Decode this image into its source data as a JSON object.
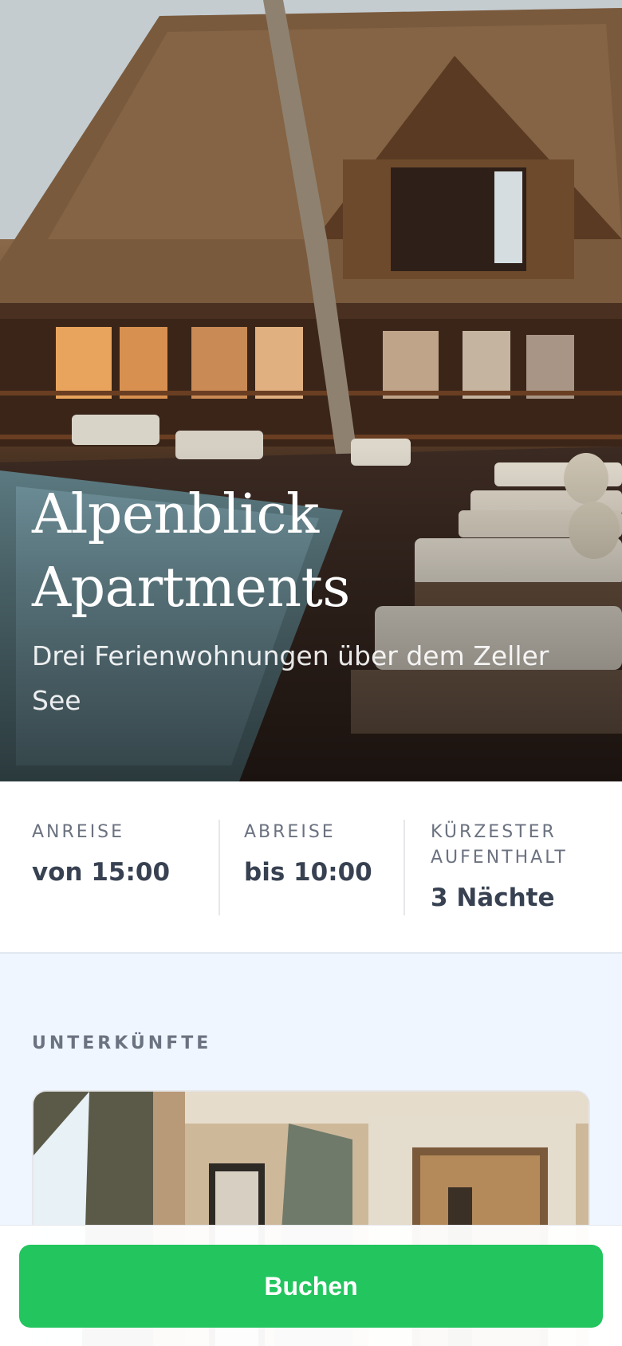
{
  "hero": {
    "title_line1": "Alpenblick",
    "title_line2": "Apartments",
    "subtitle": "Drei Ferienwohnungen über dem Zeller See"
  },
  "info": {
    "checkin_label": "ANREISE",
    "checkin_value": "von 15:00",
    "checkout_label": "ABREISE",
    "checkout_value": "bis 10:00",
    "minstay_label_line1": "KÜRZESTER",
    "minstay_label_line2": "AUFENTHALT",
    "minstay_value": "3 Nächte"
  },
  "section": {
    "accommodations_label": "UNTERKÜNFTE"
  },
  "booking": {
    "button_label": "Buchen"
  },
  "colors": {
    "accent": "#22c55e",
    "page_bg": "#eff6ff",
    "text_dark": "#374151",
    "text_muted": "#6b7280"
  }
}
